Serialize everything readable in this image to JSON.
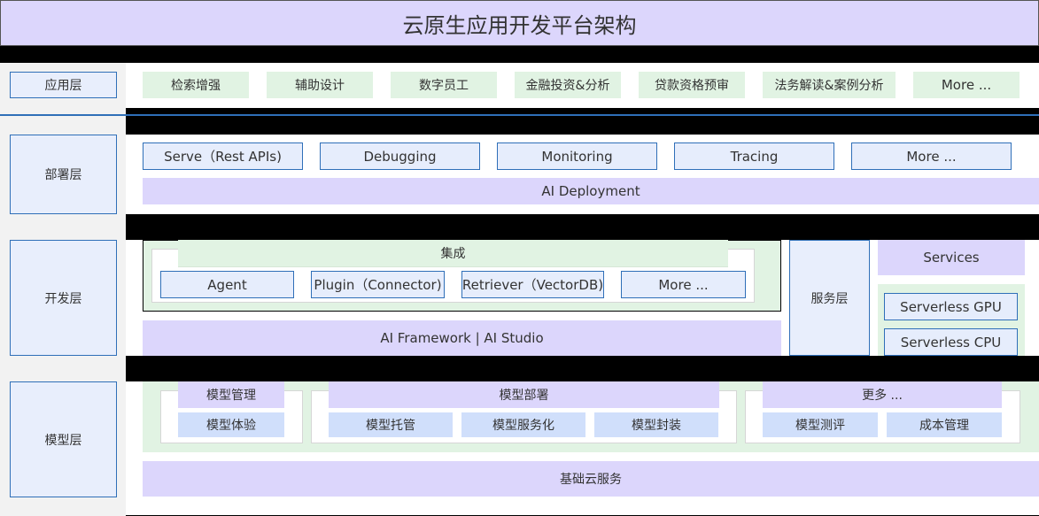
{
  "title": "云原生应用开发平台架构",
  "layers": {
    "application": {
      "label": "应用层",
      "items": [
        "检索增强",
        "辅助设计",
        "数字员工",
        "金融投资&分析",
        "贷款资格预审",
        "法务解读&案例分析",
        "More ..."
      ]
    },
    "deployment": {
      "label": "部署层",
      "items": [
        "Serve（Rest APIs)",
        "Debugging",
        "Monitoring",
        "Tracing",
        "More ..."
      ],
      "base": "AI Deployment"
    },
    "development": {
      "label": "开发层",
      "integration_title": "集成",
      "integration_items": [
        "Agent",
        "Plugin（Connector)",
        "Retriever（VectorDB)",
        "More ..."
      ],
      "framework": "AI Framework  |  AI  Studio"
    },
    "service": {
      "label": "服务层",
      "services": "Services",
      "items": [
        "Serverless GPU",
        "Serverless CPU"
      ]
    },
    "model": {
      "label": "模型层",
      "groups": [
        {
          "title": "模型管理",
          "items": [
            "模型体验"
          ]
        },
        {
          "title": "模型部署",
          "items": [
            "模型托管",
            "模型服务化",
            "模型封装"
          ]
        },
        {
          "title": "更多 ...",
          "items": [
            "模型测评",
            "成本管理"
          ]
        }
      ],
      "base": "基础云服务"
    }
  },
  "colors": {
    "title_bg": "#dcd6fc",
    "label_bg": "#e8eefc",
    "accent_border": "#2f6fb8",
    "green": "#e1f3e3",
    "purple": "#dcd6fc",
    "light_blue": "#d0dffb"
  }
}
